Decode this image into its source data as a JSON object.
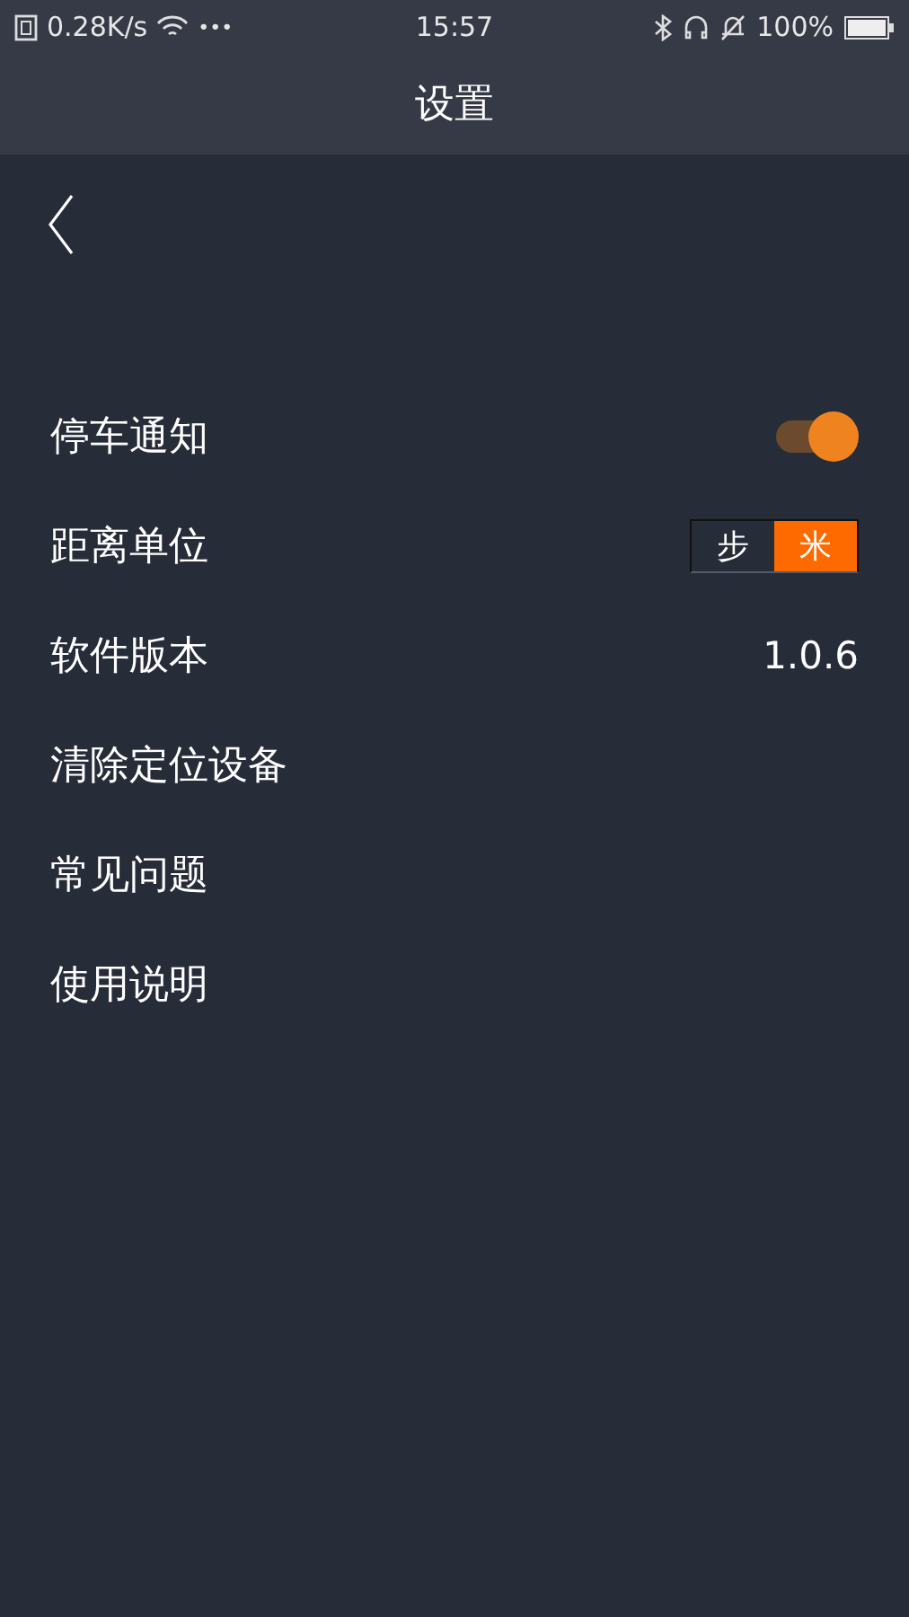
{
  "status_bar": {
    "speed": "0.28K/s",
    "dots": "•••",
    "time": "15:57",
    "battery": "100%"
  },
  "title_bar": {
    "title": "设置"
  },
  "settings": [
    {
      "kind": "toggle",
      "label": "停车通知",
      "on": true
    },
    {
      "kind": "segmented",
      "label": "距离单位",
      "options": [
        {
          "label": "步",
          "selected": false
        },
        {
          "label": "米",
          "selected": true
        }
      ]
    },
    {
      "kind": "value",
      "label": "软件版本",
      "value": "1.0.6"
    },
    {
      "kind": "plain",
      "label": "清除定位设备"
    },
    {
      "kind": "plain",
      "label": "常见问题"
    },
    {
      "kind": "plain",
      "label": "使用说明"
    }
  ]
}
